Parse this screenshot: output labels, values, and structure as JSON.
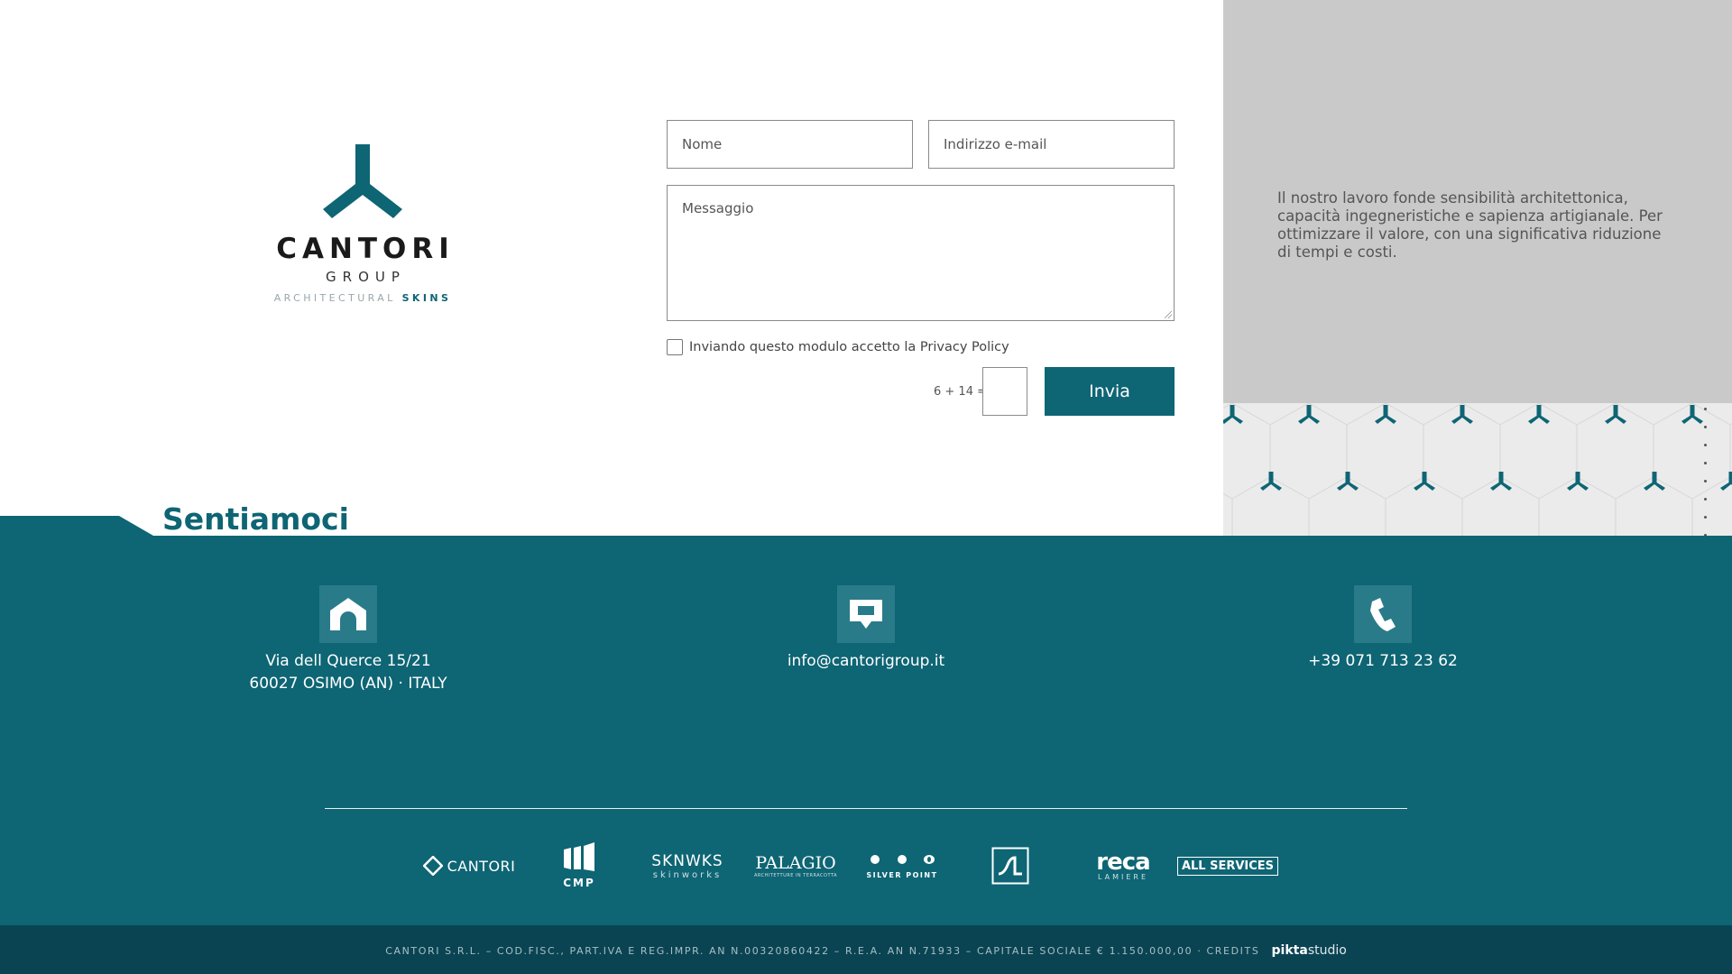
{
  "logo": {
    "name": "CANTORI",
    "group": "GROUP",
    "tagline_prefix": "ARCHITECTURAL",
    "tagline_suffix": "SKINS",
    "brand_color": "#0e6574"
  },
  "form": {
    "name_placeholder": "Nome",
    "email_placeholder": "Indirizzo e-mail",
    "message_placeholder": "Messaggio",
    "privacy_label": "Inviando questo modulo accetto la Privacy Policy",
    "captcha_question": "6 + 14 =",
    "captcha_value": "",
    "submit_label": "Invia"
  },
  "aside": {
    "text": "Il nostro lavoro fonde sensibilità architettonica, capacità ingegneristiche e sapienza artigianale. Per ottimizzare il valore, con una significativa riduzione di tempi e costi."
  },
  "section": {
    "heading": "Sentiamoci"
  },
  "contacts": {
    "address_line1": "Via dell Querce 15/21",
    "address_line2": "60027 OSIMO (AN) · ITALY",
    "email": "info@cantorigroup.it",
    "phone": "+39 071 713 23 62",
    "address_icon": "home-icon",
    "email_icon": "chat-icon",
    "phone_icon": "phone-icon"
  },
  "brands": {
    "cantori": "CANTORI",
    "cmp": "CMP",
    "sknwks": "SKNWKS",
    "sknwks_sub": "skinworks",
    "palagio": "PALAGIO",
    "palagio_sub": "ARCHITETTURE IN TERRACOTTA",
    "silverpoint": "SILVER POINT",
    "reca": "reca",
    "reca_sub": "LAMIERE",
    "allservices": "ALL SERVICES"
  },
  "footer": {
    "legal": "CANTORI S.R.L. – COD.FISC., PART.IVA E REG.IMPR. AN N.00320860422 – R.E.A. AN N.71933 – CAPITALE SOCIALE € 1.150.000,00 · CREDITS",
    "credits_bold": "pikta",
    "credits_rest": "studio"
  },
  "colors": {
    "teal": "#0e6574",
    "dark_teal": "#0a4453",
    "gray": "#c9c9c9"
  }
}
